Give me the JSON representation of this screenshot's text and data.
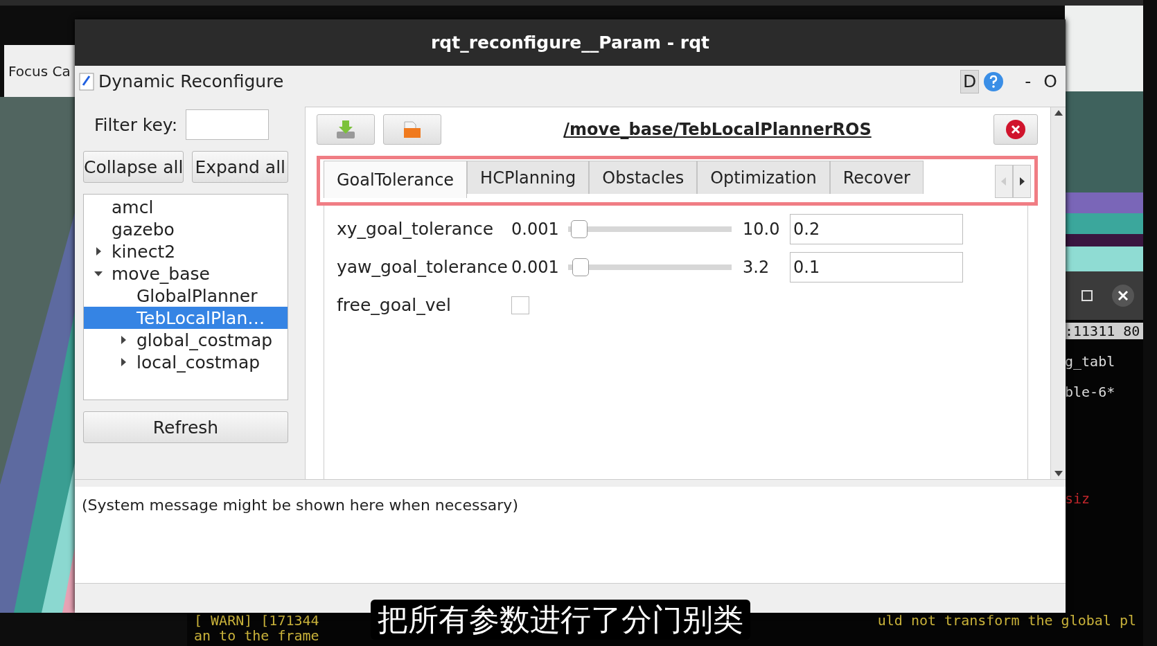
{
  "background": {
    "left_window_label": "Focus Ca",
    "terminal_lines": [
      {
        "text": ":11311 80"
      },
      {
        "text": "g_tabl"
      },
      {
        "text": "ble-6*"
      }
    ],
    "terminal_red": "siz",
    "bottom_left_lines": [
      "[ WARN] [171344",
      "an to the frame"
    ],
    "bottom_right_line": "uld not transform the global pl"
  },
  "window": {
    "title": "rqt_reconfigure__Param - rqt"
  },
  "plugin": {
    "title": "Dynamic Reconfigure",
    "buttons": [
      "D",
      "-",
      "O"
    ]
  },
  "filter": {
    "label": "Filter key:"
  },
  "tree_buttons": [
    "Collapse all",
    "Expand all"
  ],
  "tree": [
    {
      "label": "amcl",
      "selected": false
    },
    {
      "label": "gazebo",
      "selected": false
    },
    {
      "label": "kinect2",
      "selected": false,
      "expanded": false
    },
    {
      "label": "move_base",
      "selected": false,
      "expanded": true,
      "children": [
        {
          "label": "GlobalPlanner",
          "selected": false
        },
        {
          "label": "TebLocalPlan…",
          "selected": true
        },
        {
          "label": "global_costmap",
          "selected": false,
          "expanded": false
        },
        {
          "label": "local_costmap",
          "selected": false,
          "expanded": false
        }
      ]
    }
  ],
  "refresh": "Refresh",
  "node_path": "/move_base/TebLocalPlannerROS",
  "tabs": [
    {
      "label": "GoalTolerance",
      "selected": true
    },
    {
      "label": "HCPlanning",
      "selected": false
    },
    {
      "label": "Obstacles",
      "selected": false
    },
    {
      "label": "Optimization",
      "selected": false
    },
    {
      "label": "Recover",
      "selected": false
    }
  ],
  "params": [
    {
      "kind": "slider",
      "name": "xy_goal_tolerance",
      "min": "0.001",
      "max": "10.0",
      "value": "0.2",
      "level": 0.02
    },
    {
      "kind": "slider",
      "name": "yaw_goal_tolerance",
      "min": "0.001",
      "max": "3.2",
      "value": "0.1",
      "level": 0.03
    },
    {
      "kind": "checkbox",
      "name": "free_goal_vel",
      "checked": false
    }
  ],
  "message": "(System message might be shown here when necessary)",
  "subtitle": "把所有参数进行了分门别类"
}
